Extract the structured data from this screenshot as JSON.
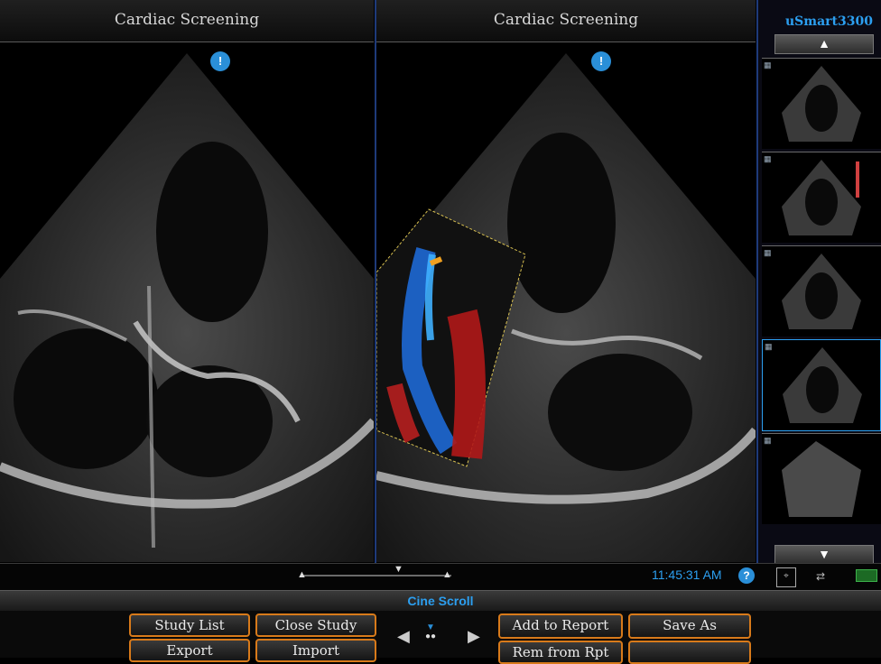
{
  "app": {
    "brand": "uSmart3300"
  },
  "panels": {
    "left_title": "Cardiac Screening",
    "right_title": "Cardiac Screening"
  },
  "icons": {
    "warning": "warning-icon",
    "help": "help-icon",
    "up": "arrow-up-icon",
    "down": "arrow-down-icon"
  },
  "status": {
    "time": "11:45:31 AM"
  },
  "cine": {
    "label": "Cine Scroll"
  },
  "softkeys": {
    "study_list": "Study List",
    "export": "Export",
    "close_study": "Close Study",
    "import": "Import",
    "add_to_report": "Add to Report",
    "rem_from_rpt": "Rem from Rpt",
    "save_as": "Save As"
  },
  "colors": {
    "accent": "#d87a1a",
    "highlight": "#2c9ff0",
    "divider": "#1e3a7a"
  }
}
